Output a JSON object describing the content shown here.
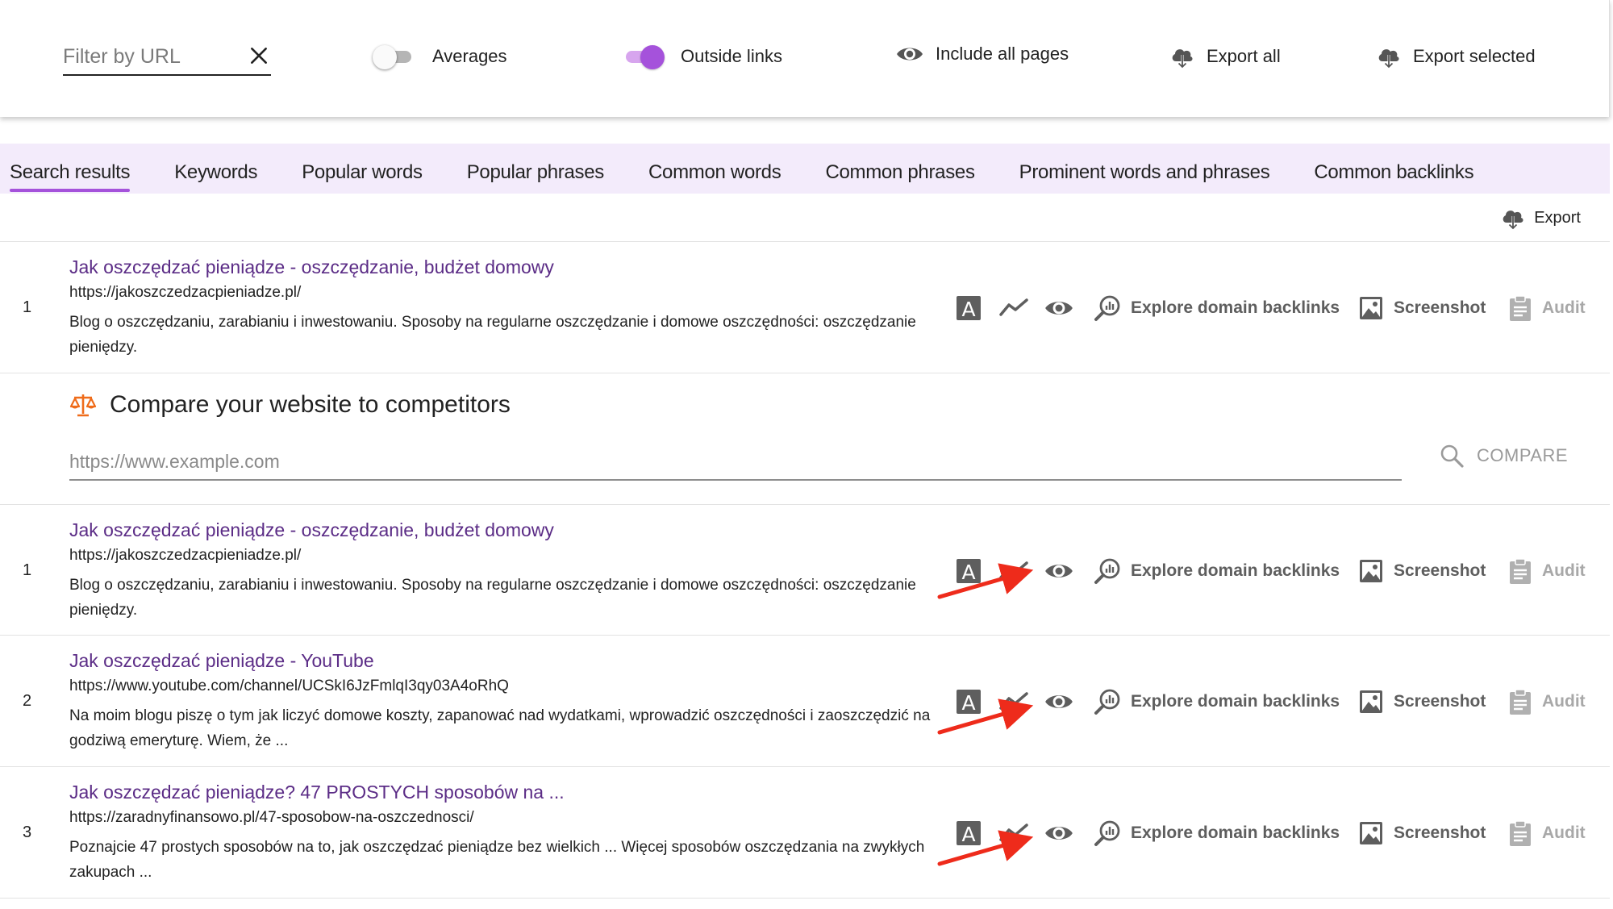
{
  "toolbar": {
    "filter_placeholder": "Filter by URL",
    "averages_label": "Averages",
    "averages_on": false,
    "outside_links_label": "Outside links",
    "outside_links_on": true,
    "include_all_pages_label": "Include all pages",
    "export_all_label": "Export all",
    "export_selected_label": "Export selected"
  },
  "tabs": [
    {
      "label": "Search results",
      "active": true
    },
    {
      "label": "Keywords"
    },
    {
      "label": "Popular words"
    },
    {
      "label": "Popular phrases"
    },
    {
      "label": "Common words"
    },
    {
      "label": "Common phrases"
    },
    {
      "label": "Prominent words and phrases"
    },
    {
      "label": "Common backlinks"
    }
  ],
  "export_label": "Export",
  "actions": {
    "backlinks_label": "Explore domain backlinks",
    "screenshot_label": "Screenshot",
    "audit_label": "Audit",
    "a_icon_letter": "A"
  },
  "featured_result": {
    "rank": "1",
    "title": "Jak oszczędzać pieniądze - oszczędzanie, budżet domowy",
    "url": "https://jakoszczedzacpieniadze.pl/",
    "description": "Blog o oszczędzaniu, zarabianiu i inwestowaniu. Sposoby na regularne oszczędzanie i domowe oszczędności: oszczędzanie pieniędzy."
  },
  "compare": {
    "title": "Compare your website to competitors",
    "placeholder": "https://www.example.com",
    "button_label": "COMPARE"
  },
  "results": [
    {
      "rank": "1",
      "title": "Jak oszczędzać pieniądze - oszczędzanie, budżet domowy",
      "url": "https://jakoszczedzacpieniadze.pl/",
      "description": "Blog o oszczędzaniu, zarabianiu i inwestowaniu. Sposoby na regularne oszczędzanie i domowe oszczędności: oszczędzanie pieniędzy."
    },
    {
      "rank": "2",
      "title": "Jak oszczędzać pieniądze - YouTube",
      "url": "https://www.youtube.com/channel/UCSkI6JzFmlqI3qy03A4oRhQ",
      "description": "Na moim blogu piszę o tym jak liczyć domowe koszty, zapanować nad wydatkami, wprowadzić oszczędności i zaoszczędzić na godziwą emeryturę. Wiem, że ..."
    },
    {
      "rank": "3",
      "title": "Jak oszczędzać pieniądze? 47 PROSTYCH sposobów na ...",
      "url": "https://zaradnyfinansowo.pl/47-sposobow-na-oszczednosci/",
      "description": "Poznajcie 47 prostych sposobów na to, jak oszczędzać pieniądze bez wielkich ... Więcej sposobów oszczędzania na zwykłych zakupach ..."
    }
  ],
  "colors": {
    "accent": "#a552db",
    "title_link": "#5b2c86",
    "tab_bar_bg": "#f3ebfb",
    "annotation_arrow": "#ee2b1b"
  }
}
